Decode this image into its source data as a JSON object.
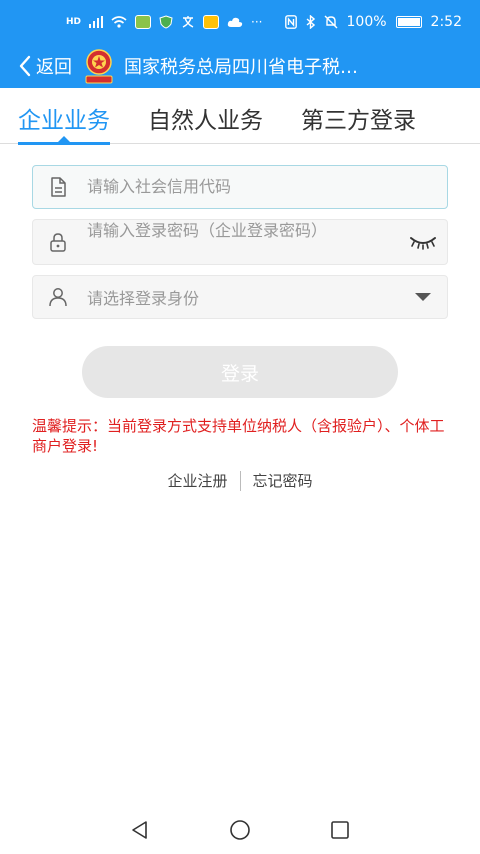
{
  "status_bar": {
    "signal_label": "HD",
    "battery_percent": "100%",
    "time": "2:52",
    "icons": [
      "hd-signal-icon",
      "signal-icon",
      "wifi-icon",
      "app-icon",
      "shield-app-icon",
      "translate-icon",
      "app-icon-2",
      "cloud-icon",
      "more-dots",
      "nfc-icon",
      "bluetooth-icon",
      "mute-icon",
      "battery-icon"
    ]
  },
  "app_bar": {
    "back_label": "返回",
    "title": "国家税务总局四川省电子税…",
    "emblem_icon": "tax-emblem-icon"
  },
  "tabs": [
    {
      "label": "企业业务",
      "active": true
    },
    {
      "label": "自然人业务",
      "active": false
    },
    {
      "label": "第三方登录",
      "active": false
    }
  ],
  "form": {
    "credit_code_placeholder": "请输入社会信用代码",
    "password_placeholder": "请输入登录密码（企业登录密码）",
    "identity_placeholder": "请选择登录身份",
    "login_label": "登录"
  },
  "tip": "温馨提示：当前登录方式支持单位纳税人（含报验户）、个体工商户登录!",
  "links": {
    "register": "企业注册",
    "forgot": "忘记密码"
  },
  "colors": {
    "primary": "#2196f3",
    "tip_red": "#e02020",
    "disabled_button": "#e6e6e6"
  }
}
